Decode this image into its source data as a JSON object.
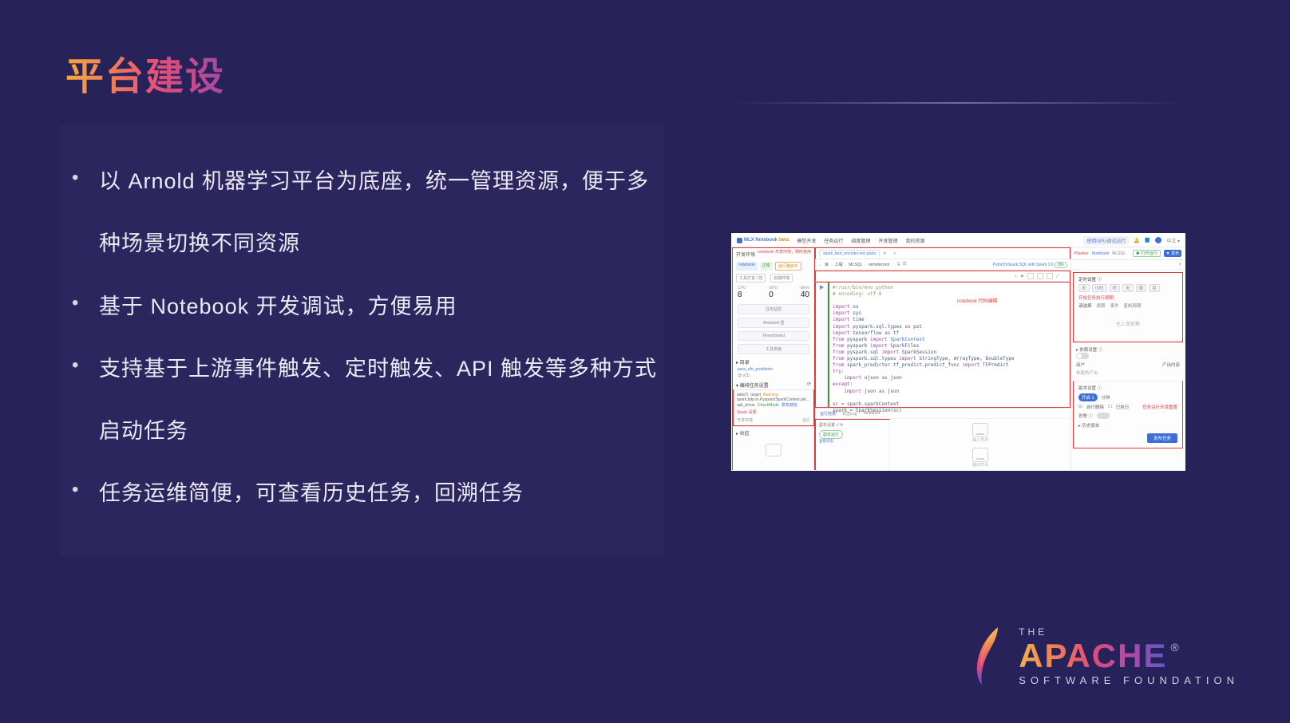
{
  "title": "平台建设",
  "bullets": [
    "以 Arnold 机器学习平台为底座，统一管理资源，便于多种场景切换不同资源",
    "基于 Notebook 开发调试，方便易用",
    "支持基于上游事件触发、定时触发、API 触发等多种方式启动任务",
    "任务运维简便，可查看历史任务，回溯任务"
  ],
  "screenshot": {
    "top": {
      "product": "MLX Notebook",
      "badge": "beta",
      "nav": [
        "模型开发",
        "任务运行",
        "调度管理",
        "开发管理",
        "我的资源"
      ],
      "right_chip": "使用GPU调试运行",
      "right_icons": [
        "bell-icon",
        "book-icon",
        "user-avatar",
        "help-icon"
      ]
    },
    "left": {
      "header": "开发环境",
      "header_note": "notebook 开发环境，随时使用",
      "chips": [
        "notebook",
        "正常",
        "运行重启中"
      ],
      "row2": [
        "工具打包 / 控"
      ],
      "open_btn": "创建终端",
      "stats": {
        "cpu": "8",
        "gpu": "0",
        "mem": "40",
        "cpu_label": "CPU",
        "gpu_label": "GPU",
        "mem_label": "Mem"
      },
      "bars": [
        "任务监控",
        "Webshell 登",
        "Tensorboard",
        "工具安装"
      ],
      "section_dir": "▸ 目录",
      "tree": [
        "para_nfo_prediction",
        "@ v15"
      ],
      "pipeline": "▾ 编排任务设置",
      "bottom": {
        "line1": [
          "dataTI",
          "target",
          "Running"
        ],
        "line2": "spark.bdp.m.Pyspark/SparkContext.pkl…",
        "cv": "CheckMode",
        "link": "发布其他",
        "spark": "Spark 设置",
        "bl": "开发环境",
        "br": "运行"
      },
      "collapse": "▸ 收起"
    },
    "center": {
      "tab": "spark_bert_encoder.enc.parts",
      "crumb": {
        "segments": [
          "目",
          "工程",
          "MLSQL",
          "remoteconn"
        ],
        "kernel": "Pytorch/Spark.SQL with Spark 3.0",
        "status": "Idle"
      },
      "toolbar": [
        "run-all-icon",
        "plus-icon",
        "cut-icon",
        "copy-icon",
        "paste-icon",
        "expand-icon"
      ],
      "code_lines": [
        "#!/usr/bin/env python",
        "# encoding: utf-8",
        "",
        "import os",
        "import sys",
        "import time",
        "import pyspark.sql.types as pst",
        "import tensorflow as tf",
        "from pyspark import SparkContext",
        "from pyspark import SparkFiles",
        "from pyspark.sql import SparkSession",
        "from pyspark.sql.types import StringType, ArrayType, DoubleType",
        "from spark_predictor.tf_predict.predict_func import TFPredict",
        "try:",
        "    import ujson as json",
        "except:",
        "    import json as json",
        "",
        "sc = spark.sparkContext",
        "spark = SparkSession(sc)"
      ],
      "code_note": "notebook 代码编辑",
      "bottom_panel": {
        "tabs": [
          "运行结果",
          "日志Log",
          "Webshell"
        ],
        "left": {
          "label": "副本设置 ✓",
          "refresh": "⟳",
          "pill": "副本运行",
          "sub": "查看日志"
        },
        "nodes": [
          "输入节点",
          "输出节点"
        ]
      }
    },
    "right": {
      "tabs": {
        "pipeline": "Pipeline",
        "notebook": "Notebook",
        "ml": "MLSQL",
        "run": "▶ 打开运行",
        "publish": "▼ 发布"
      },
      "close": "×",
      "panel1": {
        "title": "定时设置 ⓘ",
        "pills": [
          "天",
          "小时",
          "时",
          "天",
          "周",
          "月"
        ],
        "note": "开始任务执行周期",
        "opts_label": "请选择",
        "opts": [
          "周期",
          "事件",
          "复制周期"
        ]
      },
      "empty": "无上游依赖",
      "mid": {
        "title": "▸ 依赖设置 ⓘ",
        "col_user": "用户",
        "table_head": [
          "用户",
          "产出内容"
        ],
        "row": "依赖的产出"
      },
      "bottom": {
        "title": "副本设置 ⓘ",
        "pill": "开启 1",
        "extra": "分钟",
        "check1": "自行删除",
        "check2": "已执行",
        "note": "任务运行环境重置",
        "toggle_label": "告警 ⓘ",
        "history": "▸ 历史版本",
        "publish": "发布任务"
      }
    }
  },
  "footer": {
    "the": "THE",
    "name": "APACHE",
    "reg": "®",
    "sub": "SOFTWARE FOUNDATION"
  }
}
